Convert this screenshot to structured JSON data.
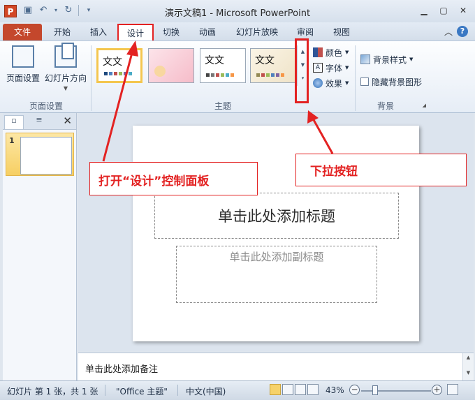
{
  "window": {
    "title": "演示文稿1 - Microsoft PowerPoint",
    "app_icon_letter": "P"
  },
  "tabs": [
    "文件",
    "开始",
    "插入",
    "设计",
    "切换",
    "动画",
    "幻灯片放映",
    "审阅",
    "视图"
  ],
  "active_tab": "设计",
  "ribbon": {
    "page_setup_label": "页面设置",
    "orientation_label": "幻灯片方向",
    "group_page_setup": "页面设置",
    "group_theme": "主题",
    "group_background": "背景",
    "theme_sample_text": "文文",
    "colors_label": "颜色",
    "fonts_label": "字体",
    "effects_label": "效果",
    "bg_style_label": "背景样式",
    "hide_bg_label": "隐藏背景图形"
  },
  "slides_pane": {
    "slide_number": "1"
  },
  "slide": {
    "title_placeholder": "单击此处添加标题",
    "subtitle_placeholder": "单击此处添加副标题"
  },
  "notes": {
    "placeholder": "单击此处添加备注"
  },
  "status": {
    "slide_info": "幻灯片 第 1 张，共 1 张",
    "theme_name": "\"Office 主题\"",
    "language": "中文(中国)",
    "zoom": "43%"
  },
  "annotations": {
    "open_design": "打开“设计”控制面板",
    "dropdown": "下拉按钮"
  },
  "colors": {
    "accent_red": "#e32222",
    "file_tab": "#c4472c",
    "selected_theme_border": "#f4c64f"
  }
}
